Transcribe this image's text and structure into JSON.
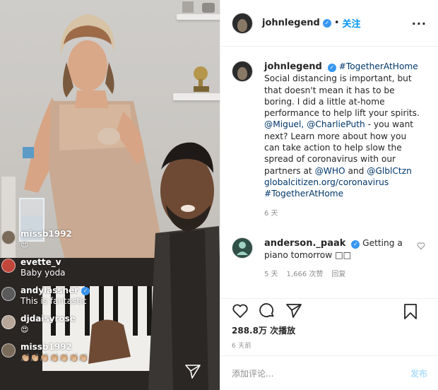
{
  "video": {
    "comments": [
      {
        "user": "missb1992",
        "text": "",
        "emoji": "😍",
        "verified": false,
        "avatar_color": "#7a6a5a"
      },
      {
        "user": "evette_v",
        "text": "Baby yoda",
        "emoji": "",
        "verified": false,
        "avatar_color": "#c2463a"
      },
      {
        "user": "andylassner",
        "text": "This is fantastic",
        "emoji": "",
        "verified": true,
        "avatar_color": "#5a5a5a"
      },
      {
        "user": "djdaisyrose",
        "text": "",
        "emoji": "😍",
        "verified": false,
        "avatar_color": "#b7a79a"
      },
      {
        "user": "missb1992",
        "text": "",
        "emoji": "👏🏼👏🏼👏🏼👏🏼👏🏼👏🏼👏🏼",
        "verified": false,
        "avatar_color": "#7a6a5a"
      }
    ]
  },
  "header": {
    "username": "johnlegend",
    "follow_label": "关注",
    "more_icon": "more-horizontal-icon"
  },
  "caption": {
    "username": "johnlegend",
    "hashtag_first": "#TogetherAtHome",
    "text_intro": "Social distancing is important, but that doesn't mean it has to be boring. I did a little at-home performance to help lift your spirits. ",
    "mention1": "@Miguel,",
    "mention2": "@CharliePuth",
    "text_mid": " - you want next? Learn more about how you can take action to help slow the spread of coronavirus with our partners at ",
    "mention3": "@WHO",
    "text_and": " and ",
    "mention4": "@GlblCtzn",
    "url": "globalcitizen.org/coronavirus",
    "hashtag_last": "#TogetherAtHome",
    "age": "6 天"
  },
  "comment": {
    "username": "anderson._paak",
    "text": "Getting a piano tomorrow",
    "trailing": "□□",
    "age": "5 天",
    "likes": "1,666 次赞",
    "reply_label": "回复"
  },
  "actions": {
    "views": "288.8万 次播放",
    "posted": "6 天前"
  },
  "add_comment": {
    "placeholder": "添加评论...",
    "post_label": "发布"
  }
}
